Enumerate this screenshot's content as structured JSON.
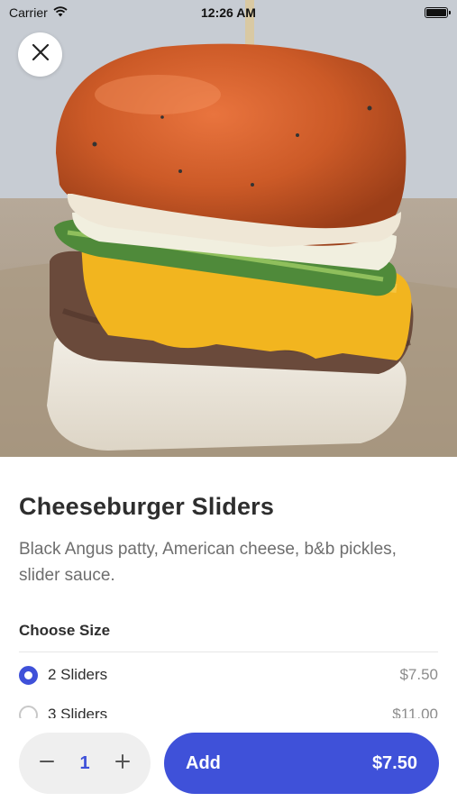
{
  "status_bar": {
    "carrier": "Carrier",
    "time": "12:26 AM"
  },
  "item": {
    "title": "Cheeseburger Sliders",
    "description": "Black Angus patty, American cheese, b&b pickles, slider sauce."
  },
  "size_section": {
    "label": "Choose Size",
    "options": [
      {
        "label": "2 Sliders",
        "price": "$7.50",
        "selected": true
      },
      {
        "label": "3 Sliders",
        "price": "$11.00",
        "selected": false
      }
    ]
  },
  "order": {
    "quantity": "1",
    "add_label": "Add",
    "total": "$7.50"
  },
  "colors": {
    "accent": "#3f51d9",
    "stepper_bg": "#efefef"
  },
  "icons": {
    "close": "close-icon",
    "minus": "minus-icon",
    "plus": "plus-icon",
    "wifi": "wifi-icon",
    "battery": "battery-icon"
  }
}
